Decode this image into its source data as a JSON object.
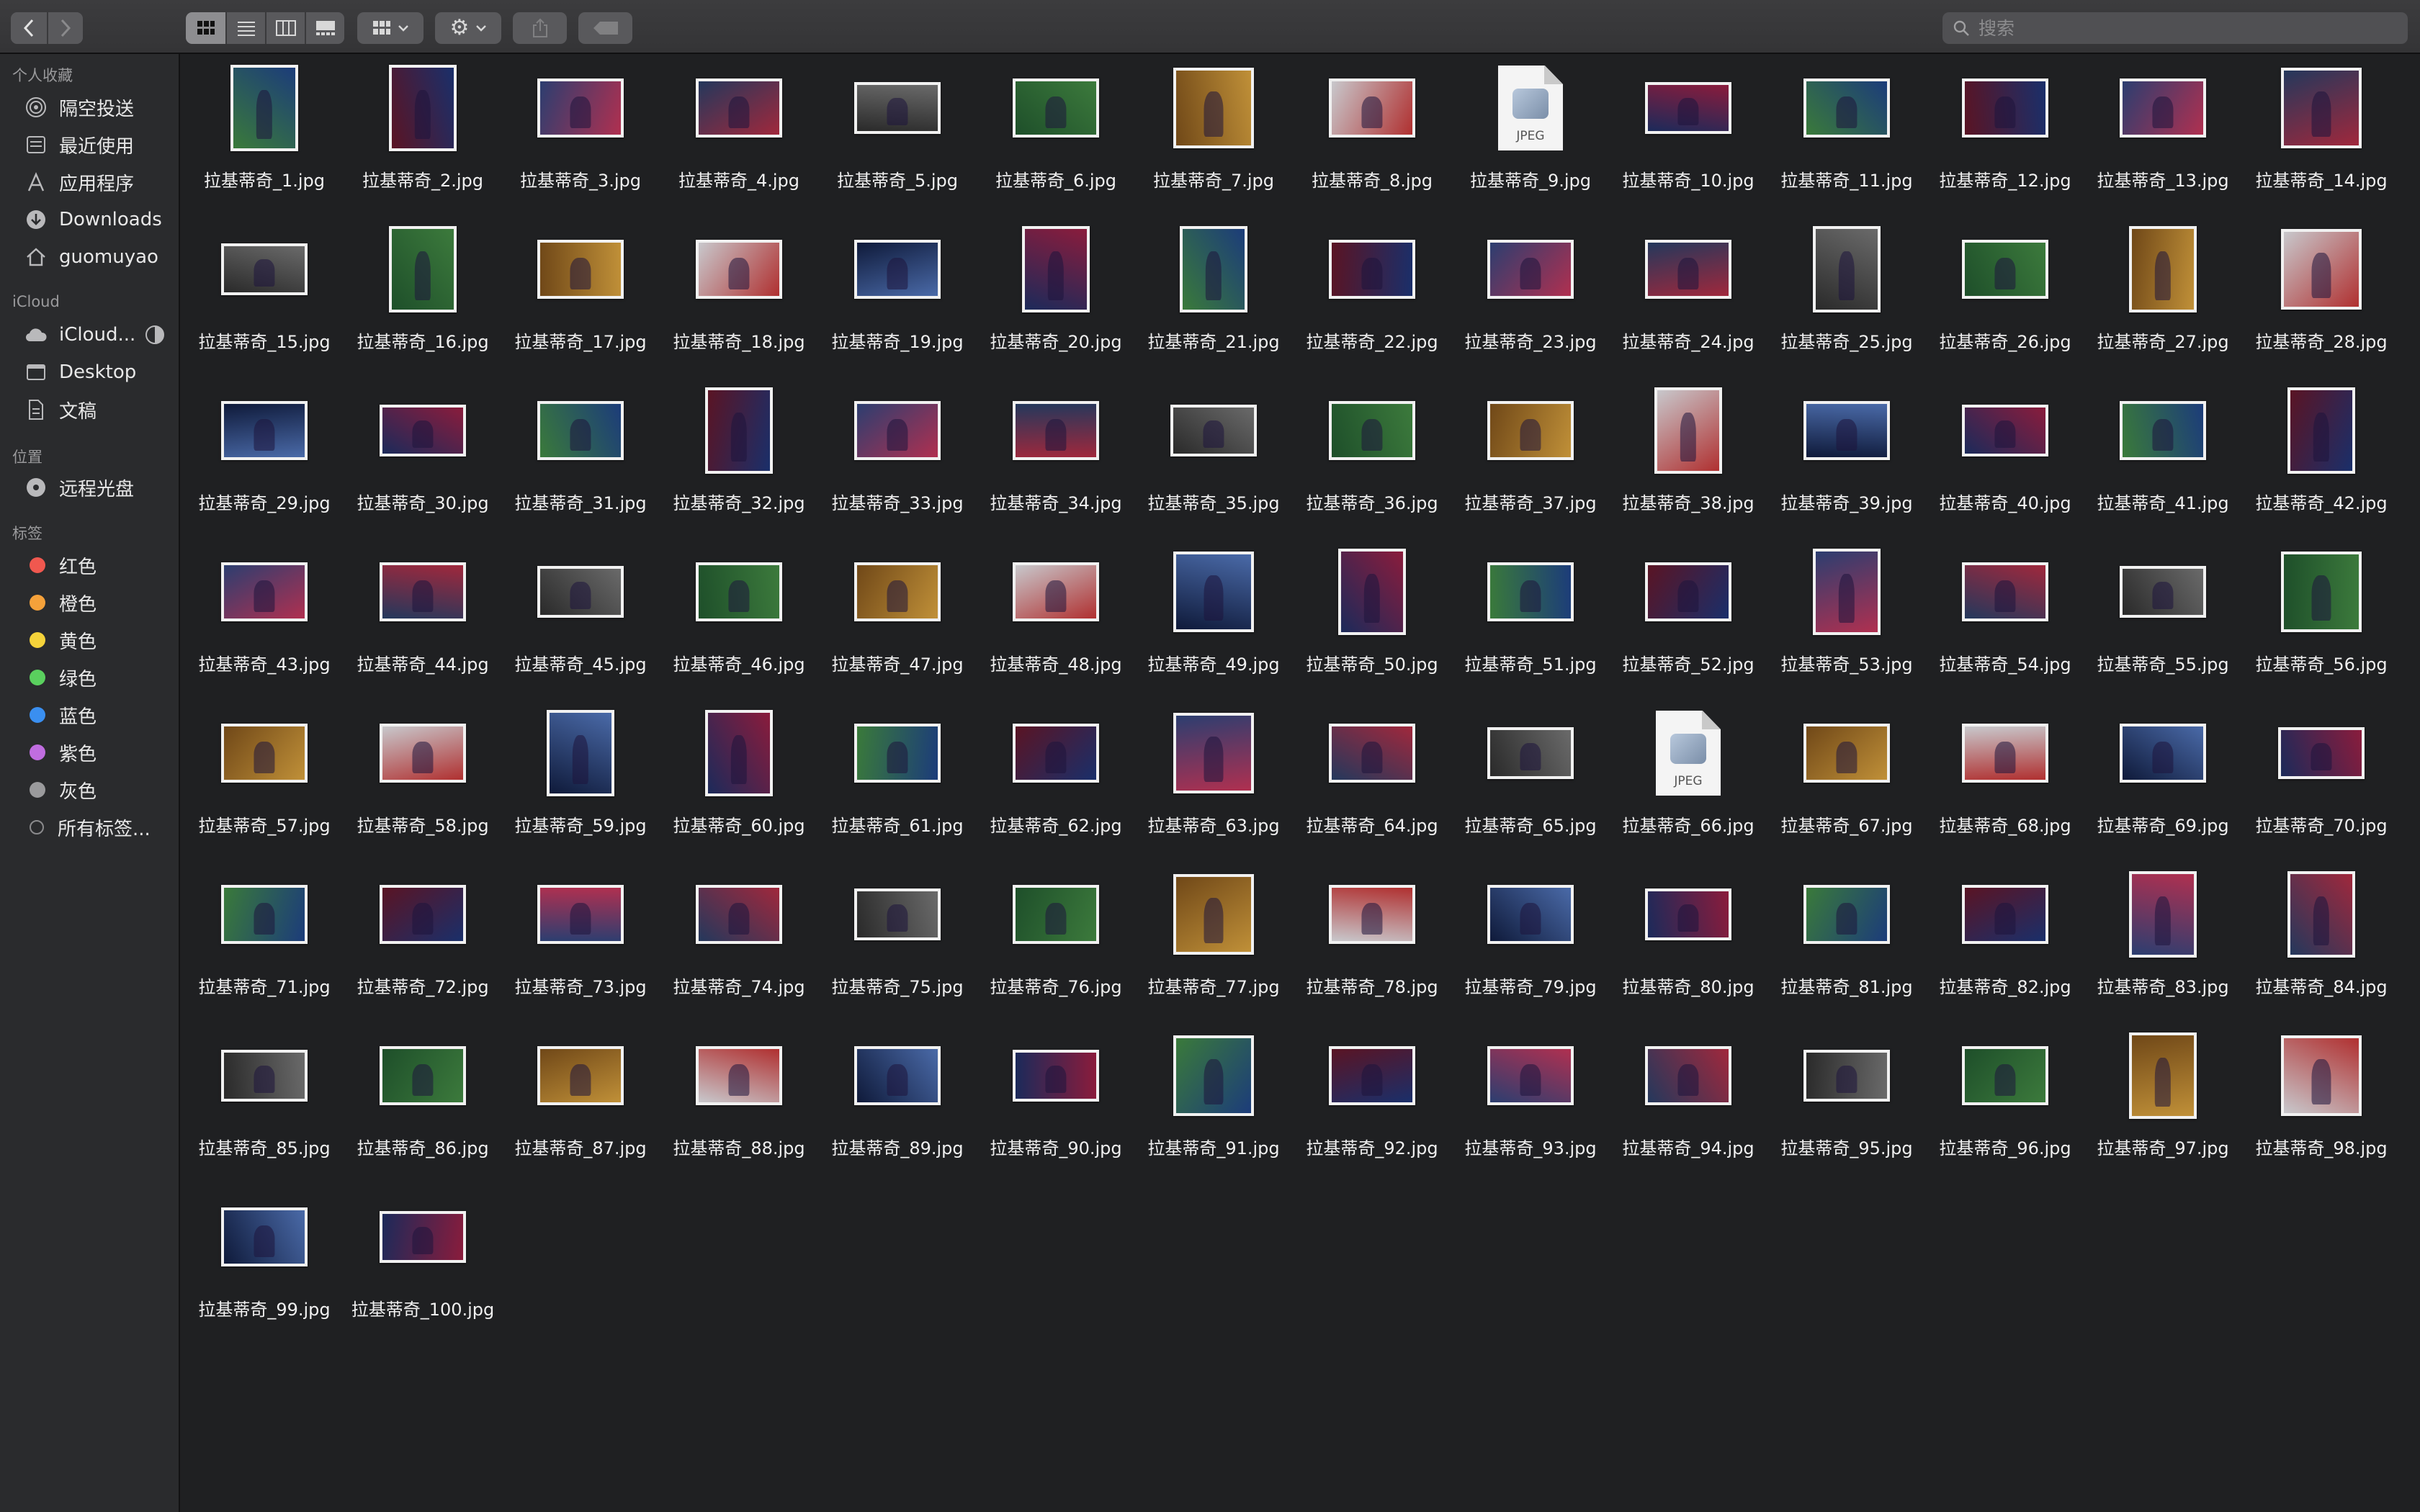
{
  "toolbar": {
    "back_label": "<",
    "forward_label": ">",
    "view_modes": [
      "icons",
      "list",
      "columns",
      "gallery"
    ],
    "active_view": "icons",
    "search_placeholder": "搜索"
  },
  "sidebar": {
    "favorites_header": "个人收藏",
    "favorites": [
      {
        "label": "隔空投送",
        "icon": "airdrop-icon"
      },
      {
        "label": "最近使用",
        "icon": "recents-icon"
      },
      {
        "label": "应用程序",
        "icon": "applications-icon"
      },
      {
        "label": "Downloads",
        "icon": "downloads-icon"
      },
      {
        "label": "guomuyao",
        "icon": "home-icon"
      }
    ],
    "icloud_header": "iCloud",
    "icloud": [
      {
        "label": "iCloud...",
        "icon": "icloud-drive-icon"
      },
      {
        "label": "Desktop",
        "icon": "desktop-folder-icon"
      },
      {
        "label": "文稿",
        "icon": "documents-icon"
      }
    ],
    "locations_header": "位置",
    "locations": [
      {
        "label": "远程光盘",
        "icon": "remote-disc-icon"
      }
    ],
    "tags_header": "标签",
    "tags": [
      {
        "label": "红色",
        "color": "#f0584f"
      },
      {
        "label": "橙色",
        "color": "#f5a13a"
      },
      {
        "label": "黄色",
        "color": "#f5d33a"
      },
      {
        "label": "绿色",
        "color": "#5ad05e"
      },
      {
        "label": "蓝色",
        "color": "#3a8ff0"
      },
      {
        "label": "紫色",
        "color": "#c06de0"
      },
      {
        "label": "灰色",
        "color": "#9a9a9c"
      }
    ],
    "all_tags_label": "所有标签..."
  },
  "files": [
    "拉基蒂奇_1.jpg",
    "拉基蒂奇_2.jpg",
    "拉基蒂奇_3.jpg",
    "拉基蒂奇_4.jpg",
    "拉基蒂奇_5.jpg",
    "拉基蒂奇_6.jpg",
    "拉基蒂奇_7.jpg",
    "拉基蒂奇_8.jpg",
    "拉基蒂奇_9.jpg",
    "拉基蒂奇_10.jpg",
    "拉基蒂奇_11.jpg",
    "拉基蒂奇_12.jpg",
    "拉基蒂奇_13.jpg",
    "拉基蒂奇_14.jpg",
    "拉基蒂奇_15.jpg",
    "拉基蒂奇_16.jpg",
    "拉基蒂奇_17.jpg",
    "拉基蒂奇_18.jpg",
    "拉基蒂奇_19.jpg",
    "拉基蒂奇_20.jpg",
    "拉基蒂奇_21.jpg",
    "拉基蒂奇_22.jpg",
    "拉基蒂奇_23.jpg",
    "拉基蒂奇_24.jpg",
    "拉基蒂奇_25.jpg",
    "拉基蒂奇_26.jpg",
    "拉基蒂奇_27.jpg",
    "拉基蒂奇_28.jpg",
    "拉基蒂奇_29.jpg",
    "拉基蒂奇_30.jpg",
    "拉基蒂奇_31.jpg",
    "拉基蒂奇_32.jpg",
    "拉基蒂奇_33.jpg",
    "拉基蒂奇_34.jpg",
    "拉基蒂奇_35.jpg",
    "拉基蒂奇_36.jpg",
    "拉基蒂奇_37.jpg",
    "拉基蒂奇_38.jpg",
    "拉基蒂奇_39.jpg",
    "拉基蒂奇_40.jpg",
    "拉基蒂奇_41.jpg",
    "拉基蒂奇_42.jpg",
    "拉基蒂奇_43.jpg",
    "拉基蒂奇_44.jpg",
    "拉基蒂奇_45.jpg",
    "拉基蒂奇_46.jpg",
    "拉基蒂奇_47.jpg",
    "拉基蒂奇_48.jpg",
    "拉基蒂奇_49.jpg",
    "拉基蒂奇_50.jpg",
    "拉基蒂奇_51.jpg",
    "拉基蒂奇_52.jpg",
    "拉基蒂奇_53.jpg",
    "拉基蒂奇_54.jpg",
    "拉基蒂奇_55.jpg",
    "拉基蒂奇_56.jpg",
    "拉基蒂奇_57.jpg",
    "拉基蒂奇_58.jpg",
    "拉基蒂奇_59.jpg",
    "拉基蒂奇_60.jpg",
    "拉基蒂奇_61.jpg",
    "拉基蒂奇_62.jpg",
    "拉基蒂奇_63.jpg",
    "拉基蒂奇_64.jpg",
    "拉基蒂奇_65.jpg",
    "拉基蒂奇_66.jpg",
    "拉基蒂奇_67.jpg",
    "拉基蒂奇_68.jpg",
    "拉基蒂奇_69.jpg",
    "拉基蒂奇_70.jpg",
    "拉基蒂奇_71.jpg",
    "拉基蒂奇_72.jpg",
    "拉基蒂奇_73.jpg",
    "拉基蒂奇_74.jpg",
    "拉基蒂奇_75.jpg",
    "拉基蒂奇_76.jpg",
    "拉基蒂奇_77.jpg",
    "拉基蒂奇_78.jpg",
    "拉基蒂奇_79.jpg",
    "拉基蒂奇_80.jpg",
    "拉基蒂奇_81.jpg",
    "拉基蒂奇_82.jpg",
    "拉基蒂奇_83.jpg",
    "拉基蒂奇_84.jpg",
    "拉基蒂奇_85.jpg",
    "拉基蒂奇_86.jpg",
    "拉基蒂奇_87.jpg",
    "拉基蒂奇_88.jpg",
    "拉基蒂奇_89.jpg",
    "拉基蒂奇_90.jpg",
    "拉基蒂奇_91.jpg",
    "拉基蒂奇_92.jpg",
    "拉基蒂奇_93.jpg",
    "拉基蒂奇_94.jpg",
    "拉基蒂奇_95.jpg",
    "拉基蒂奇_96.jpg",
    "拉基蒂奇_97.jpg",
    "拉基蒂奇_98.jpg",
    "拉基蒂奇_99.jpg",
    "拉基蒂奇_100.jpg"
  ],
  "generic_file_icon_text": "JPEG",
  "generic_icon_files": [
    9,
    66
  ],
  "portrait_files": [
    1,
    2,
    16,
    20,
    21,
    25,
    27,
    32,
    38,
    42,
    50,
    53,
    59,
    60,
    83,
    84,
    97
  ],
  "thumb_palettes": [
    [
      "#1c2a5a",
      "#8a1c3c"
    ],
    [
      "#2c3e70",
      "#b03050"
    ],
    [
      "#1e4f2a",
      "#3c7a3c"
    ],
    [
      "#0f1a3a",
      "#4a6aa8"
    ],
    [
      "#5a1424",
      "#1a2f6a"
    ],
    [
      "#2a2a2a",
      "#6a6a6a"
    ],
    [
      "#c8c8cc",
      "#b03030"
    ],
    [
      "#3a7a3a",
      "#1c3c7a"
    ],
    [
      "#24385c",
      "#a0283c"
    ],
    [
      "#704818",
      "#c09038"
    ]
  ]
}
